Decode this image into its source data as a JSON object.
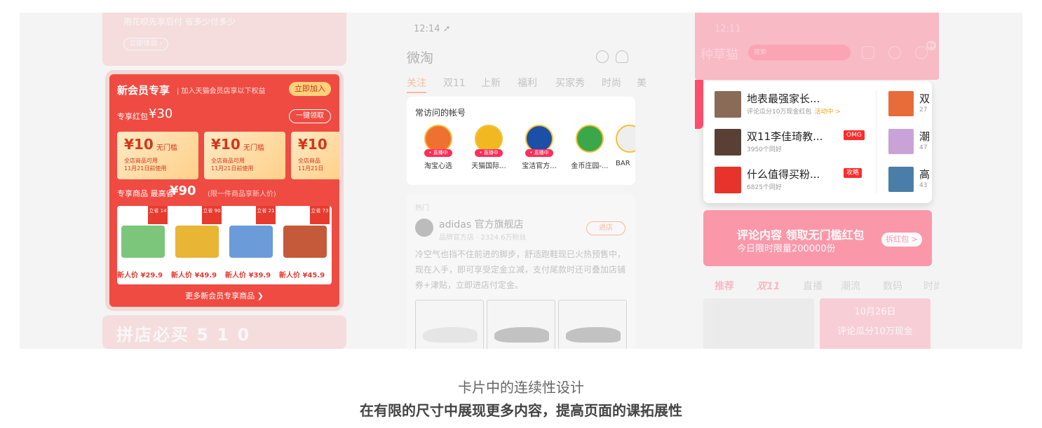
{
  "panel1": {
    "top_text": "用花呗先享后付 省多少付多少",
    "top_button": "立即体验 ›",
    "card_title": "新会员专享",
    "card_subtitle": "| 加入天猫会员店享以下权益",
    "join_button": "立即加入",
    "hongbao_label": "专享红包",
    "hongbao_value": "¥30",
    "claim_button": "一键领取",
    "coupons": [
      {
        "amount": "¥10",
        "name": "无门槛",
        "line1": "全店商品可用",
        "line2": "11月21日前使用"
      },
      {
        "amount": "¥10",
        "name": "无门槛",
        "line1": "全店商品可用",
        "line2": "11月21日前使用"
      },
      {
        "amount": "¥10",
        "name": "",
        "line1": "全店商品",
        "line2": "11月21日"
      }
    ],
    "goods_label": "专享商品 最高省",
    "goods_value": "¥90",
    "goods_note": "(限一件商品享新人价)",
    "products": [
      {
        "save": "立省 14",
        "price": "新人价 ¥29.9",
        "color": "#7bc67a"
      },
      {
        "save": "立省 90",
        "price": "新人价 ¥49.9",
        "color": "#e8b534"
      },
      {
        "save": "立省 21",
        "price": "新人价 ¥39.9",
        "color": "#6b9bd8"
      },
      {
        "save": "立省 73",
        "price": "新人价 ¥45.9",
        "color": "#c45a3a"
      }
    ],
    "more_link": "更多新会员专享商品 ❯",
    "bottom_text": "拼店必买 5 1 0"
  },
  "panel2": {
    "time": "12:14 ➚",
    "app_title": "微淘",
    "tabs": [
      "关注",
      "双11",
      "上新",
      "福利",
      "买家秀",
      "时尚",
      "美"
    ],
    "freq_title": "常访问的帐号",
    "live_label": "• 直播中",
    "accounts": [
      {
        "name": "淘宝心选",
        "color": "#f07030",
        "live": true
      },
      {
        "name": "天猫国际...",
        "color": "#f2b822",
        "live": true
      },
      {
        "name": "宝洁官方...",
        "color": "#1b4fa8",
        "live": true
      },
      {
        "name": "金币庄园-...",
        "color": "#3aa84a",
        "live": false
      },
      {
        "name": "BAR",
        "color": "#eeeeee",
        "live": false
      }
    ],
    "hot_label": "热门",
    "brand_name": "adidas 官方旗舰店",
    "brand_meta": "品牌官方店 · 2324.6万粉丝",
    "enter_button": "进店",
    "description": "冷空气也挡不住前进的脚步，舒适跑鞋现已火热预售中，现在入手，即可享受定金立减，支付尾款时还可叠加店铺券+津贴，立即进店付定金。"
  },
  "panel3": {
    "time": "12:11",
    "app_title": "种草猫",
    "search_placeholder": "搜索",
    "badge_count": "9+",
    "rows": [
      {
        "title": "地表最强家长...",
        "sub": "评论瓜分10万现金红包",
        "sub_hl": "活动中 >",
        "tag": "",
        "color": "#8a6b58"
      },
      {
        "title": "双11李佳琦教...",
        "sub": "3950个同好",
        "sub_hl": "",
        "tag": "OMG",
        "color": "#5a4034"
      },
      {
        "title": "什么值得买粉...",
        "sub": "6825个同好",
        "sub_hl": "",
        "tag": "攻略",
        "color": "#e8322c"
      }
    ],
    "mini": [
      {
        "t": "双",
        "s": "27",
        "color": "#e86b3a"
      },
      {
        "t": "潮",
        "s": "47",
        "color": "#c9a2d8"
      },
      {
        "t": "高",
        "s": "43",
        "color": "#4a7ea8"
      }
    ],
    "banner_title": "评论内容 领取无门槛红包",
    "banner_sub": "今日限时限量200000份",
    "banner_button": "拆红包 >",
    "tabs": [
      "推荐",
      "双11",
      "直播",
      "潮流",
      "数码",
      "时尚"
    ],
    "tile_date": "10月26日",
    "tile_text": "评论瓜分10万现金"
  },
  "caption": {
    "line1": "卡片中的连续性设计",
    "line2": "在有限的尺寸中展现更多内容，提高页面的课拓展性"
  }
}
